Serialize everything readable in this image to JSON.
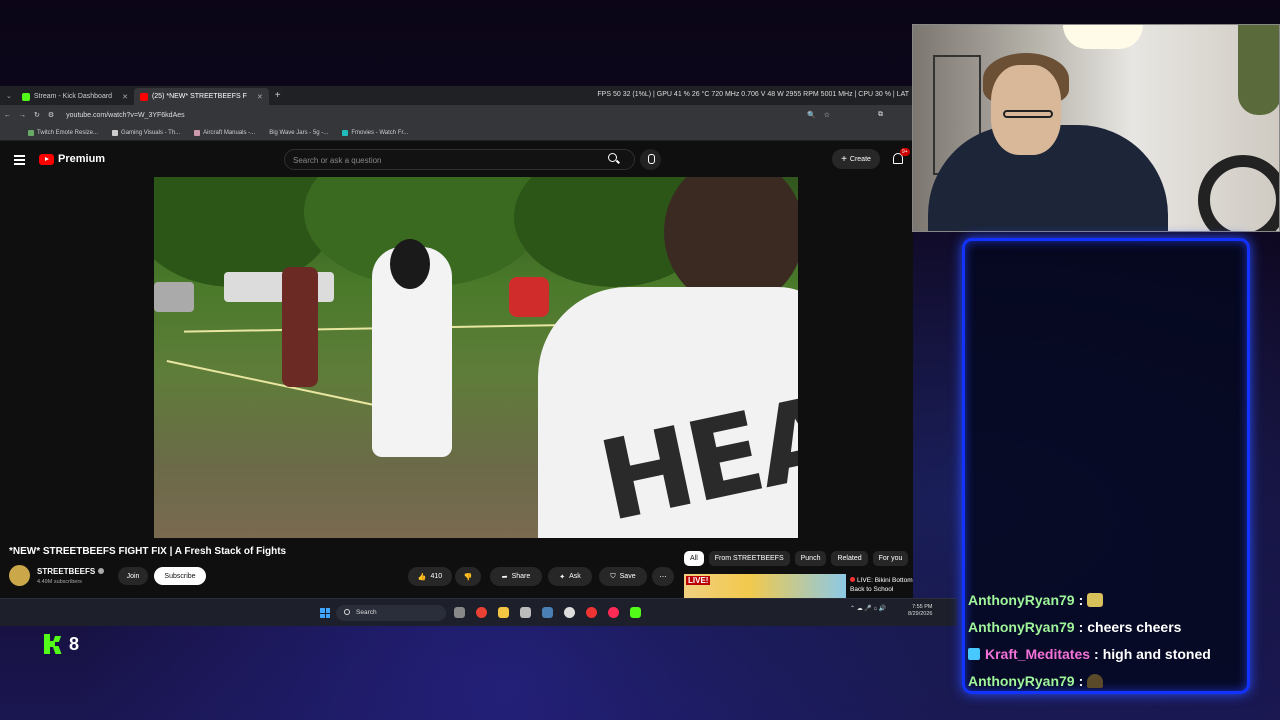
{
  "browser": {
    "tabs": [
      {
        "label": "Stream - Kick Dashboard",
        "active": false
      },
      {
        "label": "(25) *NEW* STREETBEEFS F",
        "active": true
      }
    ],
    "stats": "FPS  50   32 (1%L)  |  GPU  41 %  26 °C  720 MHz  0.706 V  48 W  2955 RPM  5001 MHz  |  CPU  30 %  |  LAT",
    "url": "youtube.com/watch?v=W_3YF6kdAes",
    "bookmarks": [
      "Twitch Emote Resize...",
      "Gaming Visuals - Th...",
      "Aircraft Manuals -...",
      "Big Wave Jars - 5g -...",
      "Fmovies - Watch Fr..."
    ]
  },
  "youtube": {
    "logo_text": "Premium",
    "search_placeholder": "Search or ask a question",
    "create_label": "Create",
    "notif_count": "9+",
    "video_title": "*NEW* STREETBEEFS FIGHT FIX | A Fresh Stack of Fights",
    "channel_name": "STREETBEEFS",
    "subscribers": "4.49M subscribers",
    "join_label": "Join",
    "subscribe_label": "Subscribe",
    "like_count": "410",
    "share_label": "Share",
    "ask_label": "Ask",
    "save_label": "Save",
    "chips": [
      "All",
      "From STREETBEEFS",
      "Punch",
      "Related",
      "For you"
    ],
    "live_badge": "LIVE!",
    "live_title_1": "LIVE: Bikini Bottom",
    "live_title_2": "Back to School",
    "shirt_text": "HEADR"
  },
  "taskbar": {
    "search_label": "Search",
    "time": "7:55 PM",
    "date": "8/29/2026"
  },
  "kick": {
    "viewer_count": "8",
    "brand_color": "#53fc18"
  },
  "chat": {
    "border_color": "#1233ff",
    "messages": [
      {
        "user": "AnthonyRyan79",
        "sep": ":",
        "text": "",
        "emote": "beer-emote"
      },
      {
        "user": "AnthonyRyan79",
        "sep": ":",
        "text": "cheers cheers"
      },
      {
        "user": "Kraft_Meditates",
        "sep": ":",
        "text": "high and stoned",
        "badge": true
      },
      {
        "user": "AnthonyRyan79",
        "sep": ":",
        "text": "",
        "emote": "hat-emote"
      }
    ]
  }
}
